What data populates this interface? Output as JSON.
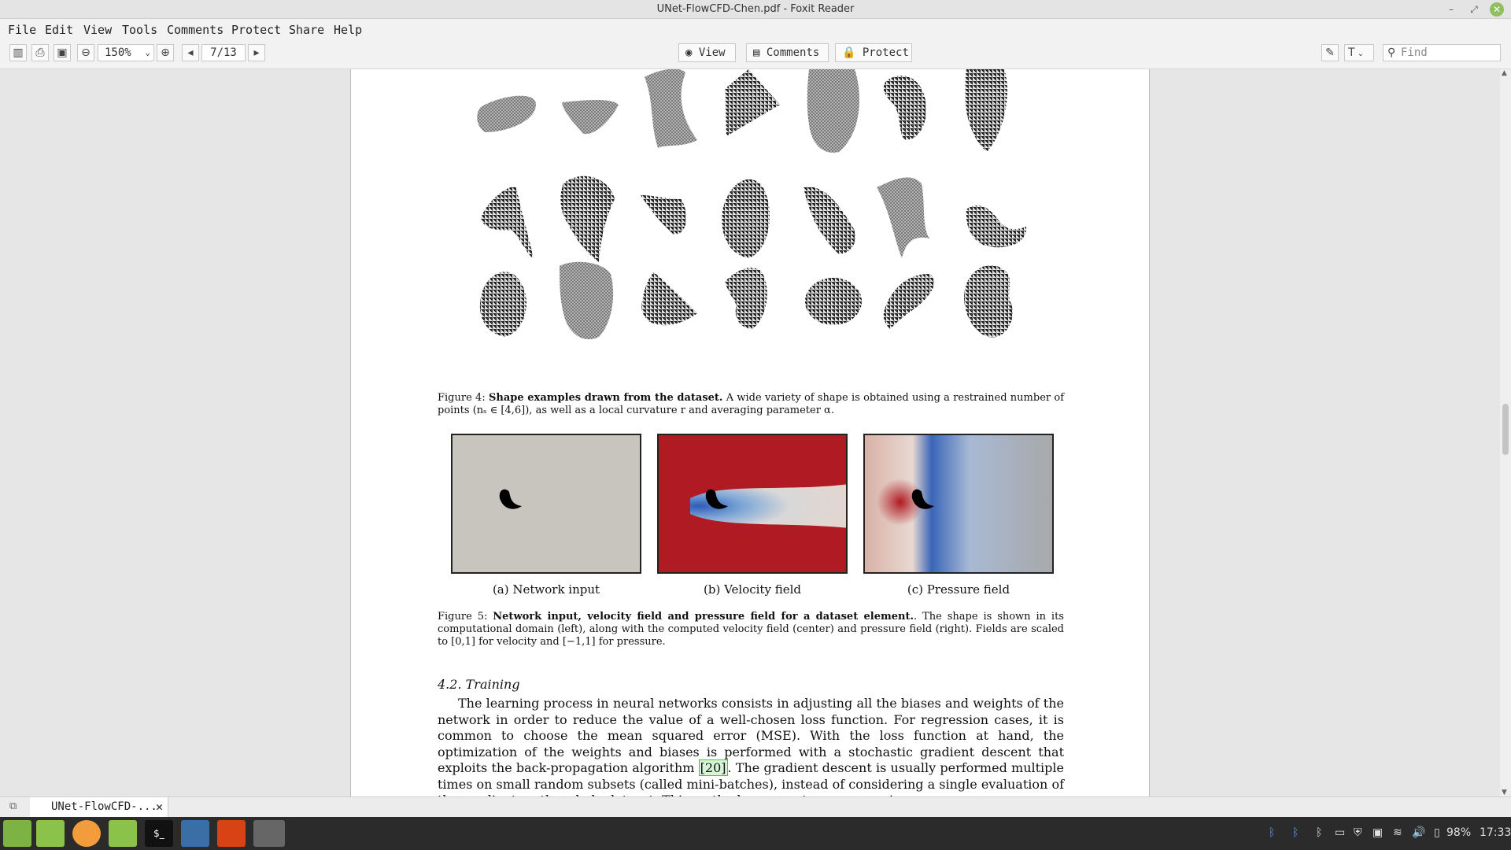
{
  "window": {
    "title": "UNet-FlowCFD-Chen.pdf - Foxit Reader"
  },
  "menu": [
    "File",
    "Edit",
    "View",
    "Tools",
    "Comments",
    "Protect",
    "Share",
    "Help"
  ],
  "toolbar": {
    "zoom": "150%",
    "page": "7/13",
    "view_label": "View",
    "comments_label": "Comments",
    "protect_label": "Protect",
    "find_placeholder": "Find"
  },
  "document": {
    "fig4": {
      "label": "Figure 4:",
      "bold": "Shape examples drawn from the dataset.",
      "text": "A wide variety of shape is obtained using a restrained number of points (nₛ ∈ [4,6]), as well as a local curvature r and averaging parameter α."
    },
    "fig5_sub": [
      "(a) Network input",
      "(b) Velocity field",
      "(c) Pressure field"
    ],
    "fig5": {
      "label": "Figure 5:",
      "bold": "Network input, velocity field and pressure field for a dataset element.",
      "text": ". The shape is shown in its computational domain (left), along with the computed velocity field (center) and pressure field (right). Fields are scaled to [0,1] for velocity and [−1,1] for pressure."
    },
    "section": "4.2. Training",
    "para_a": "The learning process in neural networks consists in adjusting all the biases and weights of the network in order to reduce the value of a well-chosen loss function. For regression cases, it is common to choose the mean squared error (MSE). With the loss function at hand, the optimization of the weights and biases is performed with a stochastic gradient descent that exploits the back-propagation algorithm",
    "ref": "[20]",
    "para_b": ". The gradient descent is usually performed multiple times on small random subsets (called mini-batches), instead of considering a single evaluation of the gradient on the whole dataset. This method represents a compromise"
  },
  "tab": {
    "label": "UNet-FlowCFD-..."
  },
  "tray": {
    "battery": "98%",
    "time": "17:33"
  },
  "colors": {
    "velocity_high": "#b01a22",
    "velocity_low": "#3a66b8",
    "pressure_bg": "#a8a8a8",
    "input_bg": "#c8c5bf"
  }
}
